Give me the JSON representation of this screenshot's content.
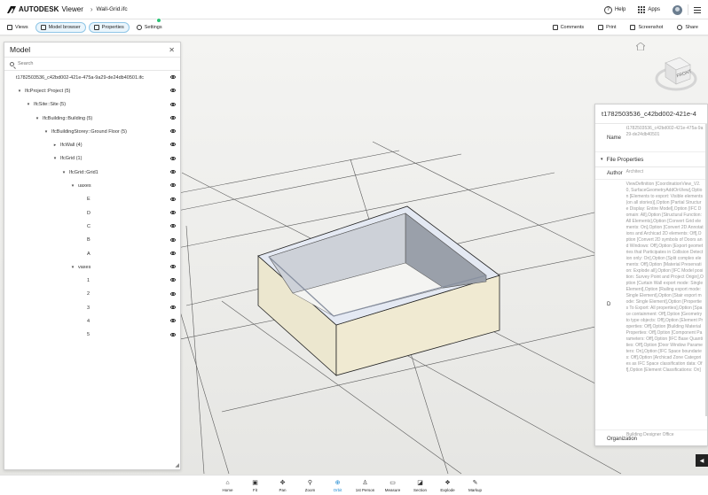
{
  "header": {
    "brand": "AUTODESK",
    "product": "Viewer",
    "file_name": "Wall-Grid.ifc",
    "help_label": "Help",
    "apps_label": "Apps"
  },
  "toolbar": {
    "views_label": "Views",
    "model_browser_label": "Model browser",
    "properties_label": "Properties",
    "settings_label": "Settings",
    "comments_label": "Comments",
    "print_label": "Print",
    "screenshot_label": "Screenshot",
    "share_label": "Share"
  },
  "model_panel": {
    "title": "Model",
    "search_placeholder": "Search",
    "tree": [
      {
        "label": "t1782503536_c42bd002-421e-475a-9a29-de24db40501.ifc",
        "depth": 0,
        "toggle": ""
      },
      {
        "label": "IfcProject::Project (5)",
        "depth": 1,
        "toggle": "▾"
      },
      {
        "label": "IfcSite::Site (5)",
        "depth": 2,
        "toggle": "▾"
      },
      {
        "label": "IfcBuilding::Building (5)",
        "depth": 3,
        "toggle": "▾"
      },
      {
        "label": "IfcBuildingStorey::Ground Floor (5)",
        "depth": 4,
        "toggle": "▾"
      },
      {
        "label": "IfcWall (4)",
        "depth": 5,
        "toggle": "▸"
      },
      {
        "label": "IfcGrid (1)",
        "depth": 5,
        "toggle": "▾"
      },
      {
        "label": "IfcGrid::Grid1",
        "depth": 6,
        "toggle": "▾"
      },
      {
        "label": "uaxes",
        "depth": 7,
        "toggle": "▾"
      },
      {
        "label": "E",
        "depth": 8,
        "toggle": ""
      },
      {
        "label": "D",
        "depth": 8,
        "toggle": ""
      },
      {
        "label": "C",
        "depth": 8,
        "toggle": ""
      },
      {
        "label": "B",
        "depth": 8,
        "toggle": ""
      },
      {
        "label": "A",
        "depth": 8,
        "toggle": ""
      },
      {
        "label": "vaxes",
        "depth": 7,
        "toggle": "▾"
      },
      {
        "label": "1",
        "depth": 8,
        "toggle": ""
      },
      {
        "label": "2",
        "depth": 8,
        "toggle": ""
      },
      {
        "label": "3",
        "depth": 8,
        "toggle": ""
      },
      {
        "label": "4",
        "depth": 8,
        "toggle": ""
      },
      {
        "label": "5",
        "depth": 8,
        "toggle": ""
      }
    ]
  },
  "properties": {
    "title": "t1782503536_c42bd002-421e-4",
    "name_key": "Name",
    "name_value": "t1782503536_c42bd002-421e-475a-9a29-de24db40501",
    "section_label": "File Properties",
    "author_key": "Author",
    "author_value": "Architect",
    "d_key": "D",
    "d_value": "ViewDefinition [CoordinationView_V2.0, SurfaceGeometryAddOnView],Option [Elements to export: Visible elements (on all stories)],Option [Partial Structure Display: Entire Model],Option [IFC Domain: All],Option [Structural Function: All Elements],Option [Convert Grid elements: On],Option [Convert 2D Annotations and Archicad 2D elements: Off],Option [Convert 2D symbols of Doors and Windows: Off],Option [Export geometries that Participates in Collision Detection only: On],Option [Split complex elements: Off],Option [Material Preservation: Explode all],Option [IFC Model position: Survey Point and Project Origin],Option [Curtain Wall export mode: Single Element],Option [Railing export mode: Single Element],Option [Stair export mode: Single Element],Option [Properties To Export: All properties],Option [Space containment: Off],Option [Geometry to type objects: Off],Option [Element Properties: Off],Option [Building Material Properties: Off],Option [Component Parameters: Off],Option [IFC Base Quantities: Off],Option [Door Window Parameters: On],Option [IFC Space boundaries: Off],Option [Archicad Zone Categories as IFC Space classification data: Off],Option [Element Classifications: On]",
    "org_key": "Organization",
    "org_value": "Building Designer Office"
  },
  "viewcube": {
    "front_label": "FRONT"
  },
  "bottom_toolbar": [
    {
      "label": "Home",
      "icon": "home-icon",
      "glyph": "⌂"
    },
    {
      "label": "Fit",
      "icon": "fit-icon",
      "glyph": "▣"
    },
    {
      "label": "Pan",
      "icon": "pan-icon",
      "glyph": "✥"
    },
    {
      "label": "Zoom",
      "icon": "zoom-icon",
      "glyph": "⚲"
    },
    {
      "label": "Orbit",
      "icon": "orbit-icon",
      "glyph": "⊕"
    },
    {
      "label": "1st Person",
      "icon": "first-person-icon",
      "glyph": "♙"
    },
    {
      "label": "Measure",
      "icon": "measure-icon",
      "glyph": "▭"
    },
    {
      "label": "Section",
      "icon": "section-icon",
      "glyph": "◪"
    },
    {
      "label": "Explode",
      "icon": "explode-icon",
      "glyph": "❖"
    },
    {
      "label": "Markup",
      "icon": "markup-icon",
      "glyph": "✎"
    }
  ],
  "colors": {
    "accent": "#1c88d0",
    "wall_top": "#e4e9f3",
    "wall_inner_light": "#f2f4f8",
    "wall_inner_dark": "#9aa0aa",
    "wall_outer_front": "#f0ead2",
    "wall_outer_left": "#ece7cf"
  }
}
